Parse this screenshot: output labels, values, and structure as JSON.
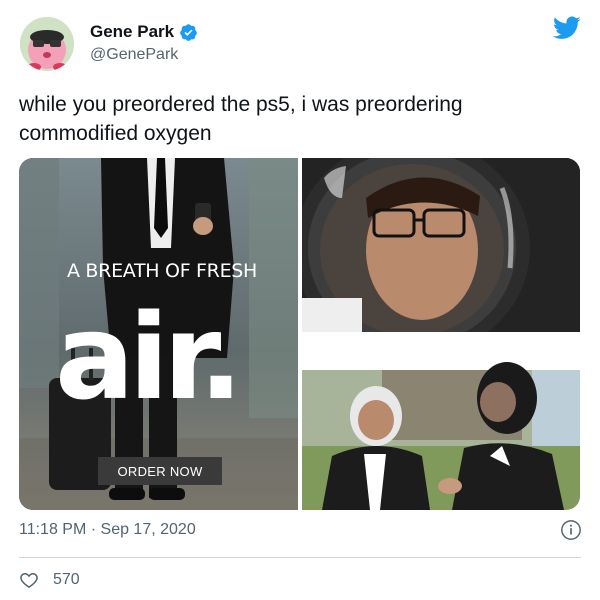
{
  "author": {
    "name": "Gene Park",
    "handle": "@GenePark",
    "verified": true
  },
  "tweet": {
    "text": "while you preordered the ps5, i was preordering commodified oxygen"
  },
  "media": {
    "ad": {
      "tagline": "A BREATH OF FRESH",
      "logo": "air.",
      "cta": "ORDER NOW"
    }
  },
  "footer": {
    "timestamp": "11:18 PM · Sep 17, 2020",
    "likes": "570"
  },
  "colors": {
    "brand_blue": "#1d9bf0",
    "text_primary": "#0f1419",
    "text_secondary": "#536471",
    "divider": "#cfd9de"
  },
  "icons": [
    "verified-badge-icon",
    "twitter-bird-icon",
    "info-icon",
    "heart-icon"
  ]
}
